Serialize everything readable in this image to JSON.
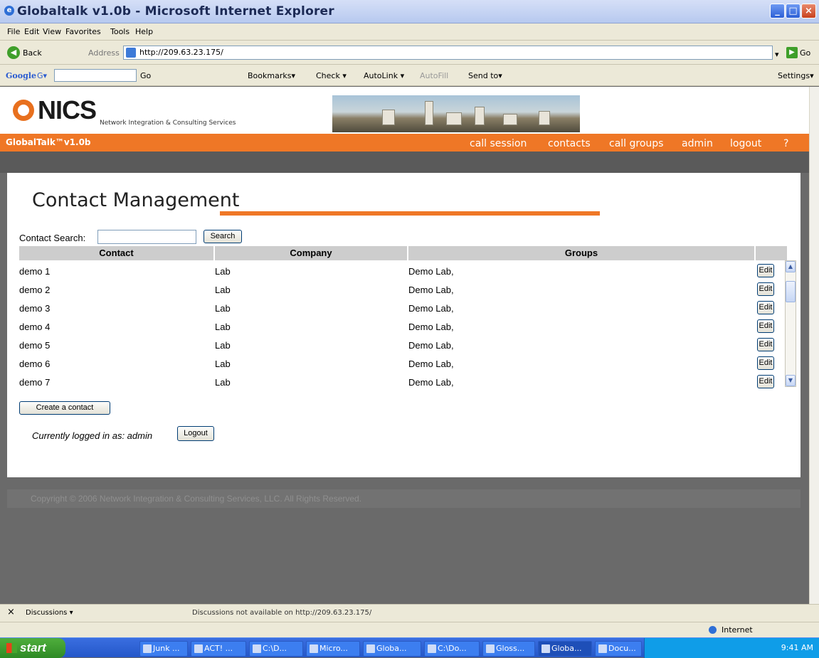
{
  "window": {
    "title": "Globaltalk v1.0b - Microsoft Internet Explorer",
    "ie_glyph": "e"
  },
  "menu": [
    "File",
    "Edit",
    "View",
    "Favorites",
    "Tools",
    "Help"
  ],
  "toolbar": {
    "back": "Back",
    "back_glyph": "◀",
    "address_label": "Address",
    "url": "http://209.63.23.175/",
    "go": "Go",
    "go_glyph": "▶",
    "dropdown_glyph": "▾"
  },
  "googlebar": {
    "logo": "Google",
    "g_glyph": "G▾",
    "go": "Go",
    "bookmarks": "Bookmarks▾",
    "check": "Check ▾",
    "autolink": "AutoLink ▾",
    "autofill": "AutoFill",
    "sendto": "Send to▾",
    "settings": "Settings▾"
  },
  "brand": {
    "logo": "NICS",
    "subtitle": "Network Integration & Consulting Services",
    "app": "GlobalTalk™v1.0b"
  },
  "nav": [
    "call session",
    "contacts",
    "call groups",
    "admin",
    "logout",
    "?"
  ],
  "page": {
    "heading": "Contact Management",
    "search_label": "Contact Search:",
    "search_value": "",
    "search_button": "Search",
    "create_button": "Create a contact",
    "logged_in": "Currently logged in as: admin",
    "logout_button": "Logout"
  },
  "table": {
    "columns": [
      "Contact",
      "Company",
      "Groups"
    ],
    "edit_label": "Edit",
    "rows": [
      {
        "contact": "demo 1",
        "company": "Lab",
        "groups": "Demo Lab,"
      },
      {
        "contact": "demo 2",
        "company": "Lab",
        "groups": "Demo Lab,"
      },
      {
        "contact": "demo 3",
        "company": "Lab",
        "groups": "Demo Lab,"
      },
      {
        "contact": "demo 4",
        "company": "Lab",
        "groups": "Demo Lab,"
      },
      {
        "contact": "demo 5",
        "company": "Lab",
        "groups": "Demo Lab,"
      },
      {
        "contact": "demo 6",
        "company": "Lab",
        "groups": "Demo Lab,"
      },
      {
        "contact": "demo 7",
        "company": "Lab",
        "groups": "Demo Lab,"
      }
    ],
    "scroll_up": "▲",
    "scroll_down": "▼"
  },
  "footer": {
    "copyright": "Copyright © 2006 Network Integration & Consulting Services, LLC. All Rights Reserved."
  },
  "discussions": {
    "label": "Discussions ▾",
    "message": "Discussions not available on http://209.63.23.175/",
    "close": "×"
  },
  "status": {
    "zone": "Internet"
  },
  "taskbar": {
    "start": "start",
    "items": [
      "Junk ...",
      "ACT! ...",
      "C:\\D...",
      "Micro...",
      "Globa...",
      "C:\\Do...",
      "Gloss...",
      "Globa...",
      "Docu..."
    ],
    "clock": "9:41 AM"
  },
  "colors": {
    "accent": "#ef7726",
    "panel": "#ffffff",
    "background": "#6a6a6a"
  }
}
